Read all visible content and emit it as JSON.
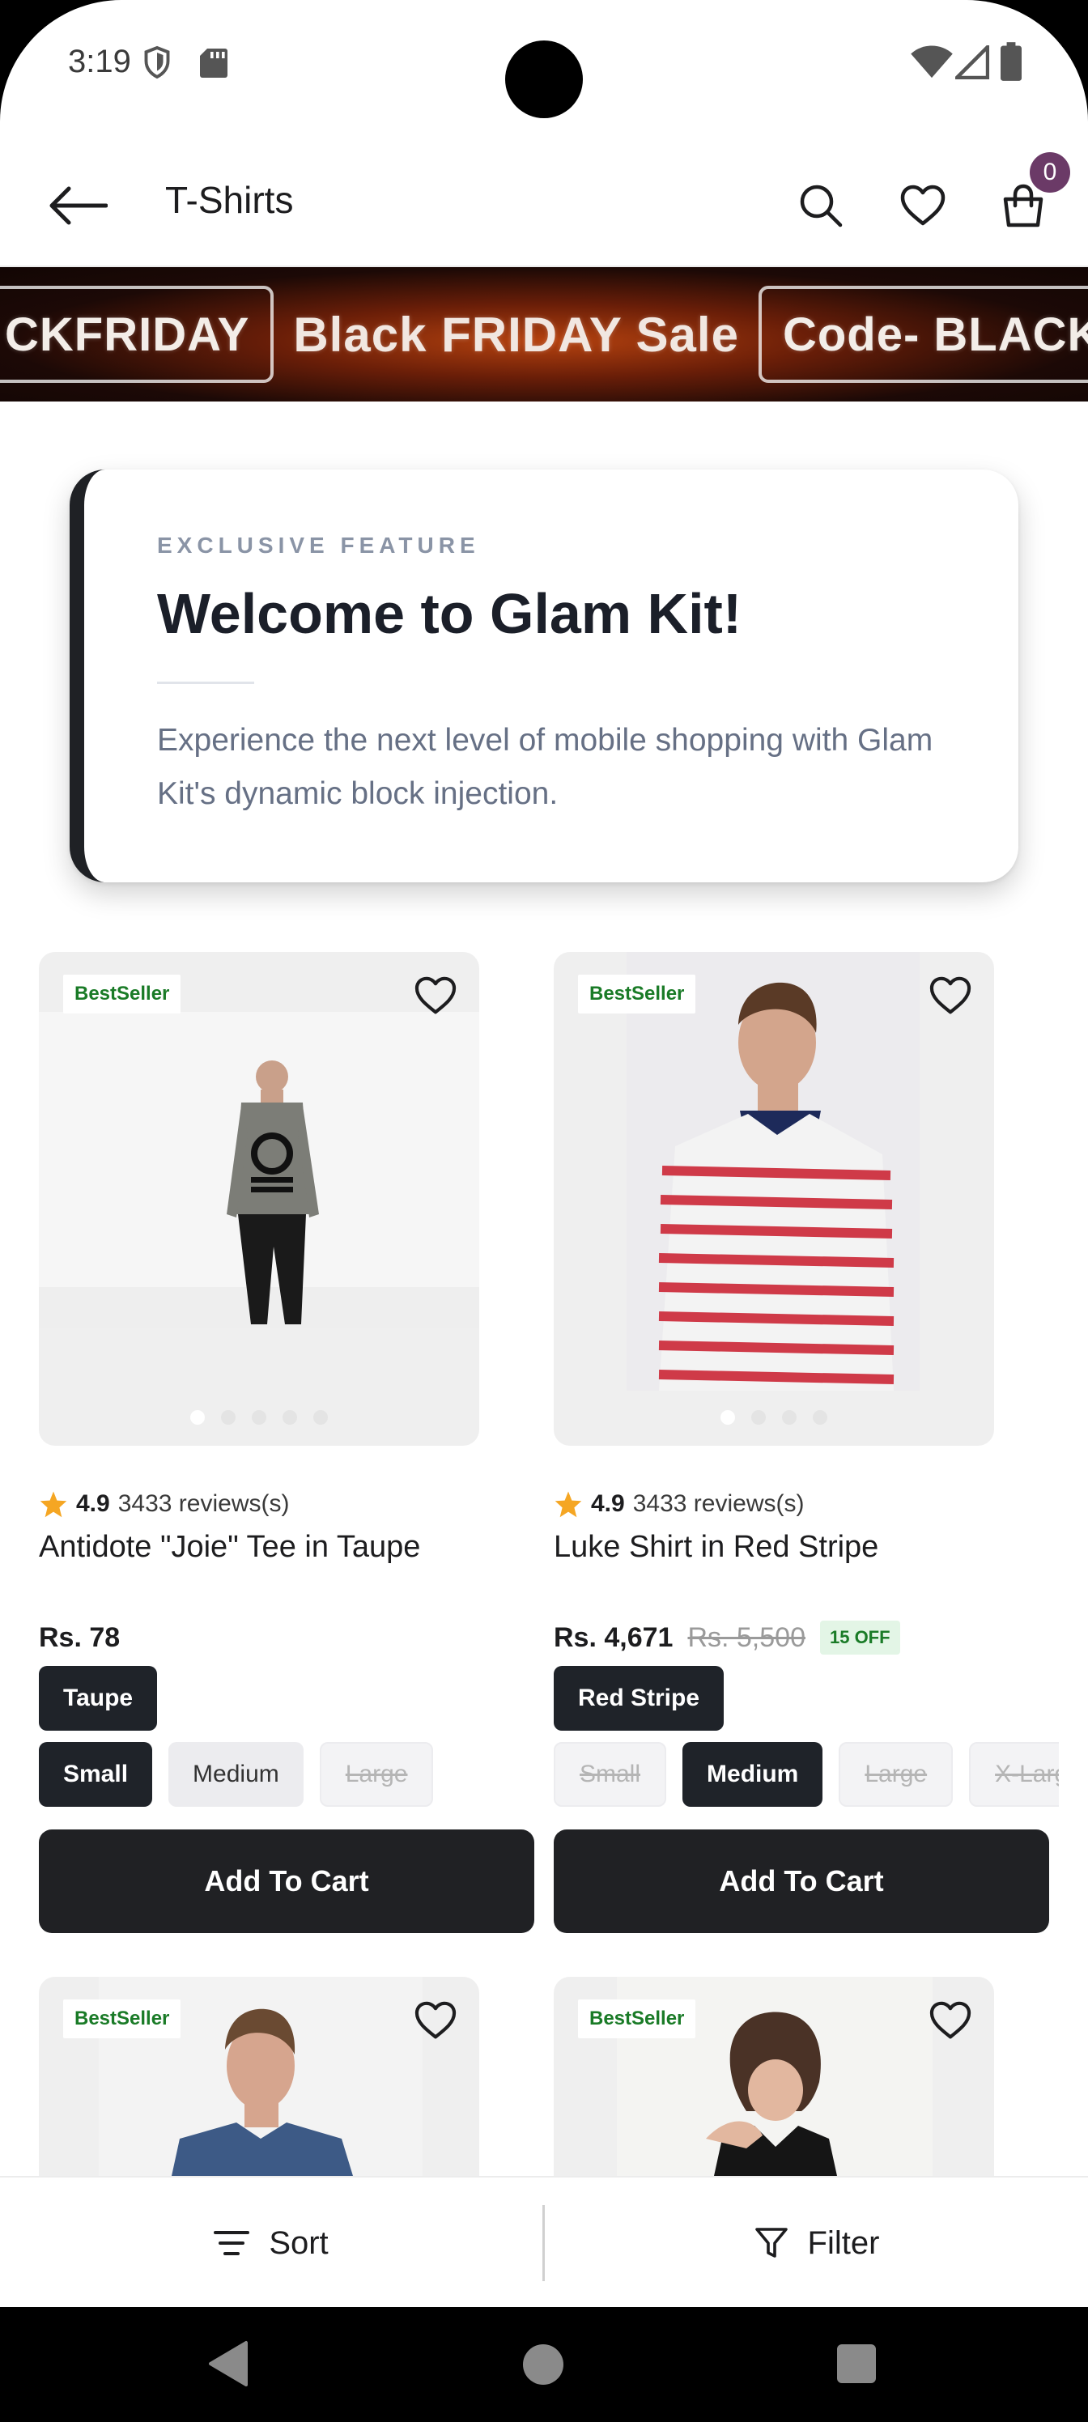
{
  "status_bar": {
    "time": "3:19"
  },
  "app_bar": {
    "title": "T-Shirts",
    "cart_count": "0"
  },
  "promo": {
    "texts": [
      "CKFRIDAY",
      "Black FRIDAY Sale",
      "Code- BLACK"
    ]
  },
  "feature": {
    "eyebrow": "EXCLUSIVE FEATURE",
    "title": "Welcome to Glam Kit!",
    "body": "Experience the next level of mobile shopping with Glam Kit's dynamic block injection."
  },
  "products": [
    {
      "badge": "BestSeller",
      "rating": "4.9",
      "reviews": "3433 reviews(s)",
      "name": "Antidote \"Joie\" Tee in Taupe",
      "price": "Rs. 78",
      "colors": [
        "Taupe"
      ],
      "sizes": [
        "Small",
        "Medium",
        "Large"
      ],
      "add_to_cart": "Add To Cart"
    },
    {
      "badge": "BestSeller",
      "rating": "4.9",
      "reviews": "3433 reviews(s)",
      "name": "Luke Shirt in Red Stripe",
      "price": "Rs. 4,671",
      "old_price": "Rs. 5,500",
      "discount": "15 OFF",
      "colors": [
        "Red Stripe"
      ],
      "sizes": [
        "Small",
        "Medium",
        "Large",
        "X-Large"
      ],
      "add_to_cart": "Add To Cart"
    },
    {
      "badge": "BestSeller"
    },
    {
      "badge": "BestSeller"
    }
  ],
  "bottom_bar": {
    "sort": "Sort",
    "filter": "Filter"
  },
  "colors": {
    "dark": "#1f2329",
    "badge_green": "#1a7b27",
    "cart_badge": "#6b3a67",
    "star": "#f5a623"
  }
}
